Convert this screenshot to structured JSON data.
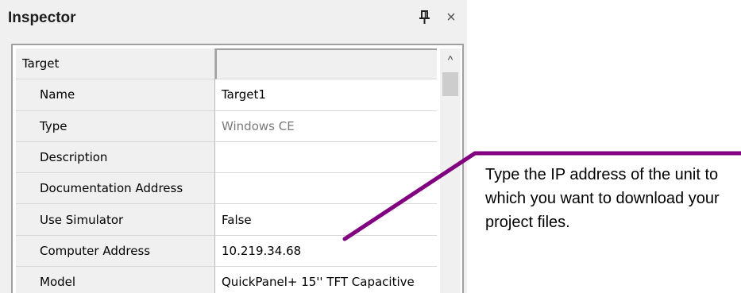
{
  "panel": {
    "title": "Inspector",
    "pin_icon": "pin-icon",
    "close_glyph": "×"
  },
  "grid": {
    "category": {
      "name": "Target",
      "value": ""
    },
    "rows": [
      {
        "name": "Name",
        "value": "Target1",
        "readonly": false
      },
      {
        "name": "Type",
        "value": "Windows CE",
        "readonly": true
      },
      {
        "name": "Description",
        "value": "",
        "readonly": false
      },
      {
        "name": "Documentation Address",
        "value": "",
        "readonly": false
      },
      {
        "name": "Use Simulator",
        "value": "False",
        "readonly": false
      },
      {
        "name": "Computer Address",
        "value": "10.219.34.68",
        "readonly": false
      },
      {
        "name": "Model",
        "value": "QuickPanel+ 15'' TFT Capacitive",
        "readonly": false
      }
    ]
  },
  "scrollbar": {
    "up_glyph": "^"
  },
  "annotation": {
    "text": "Type the IP address of the unit to which you want to download your project files.",
    "line_color": "#800080"
  }
}
